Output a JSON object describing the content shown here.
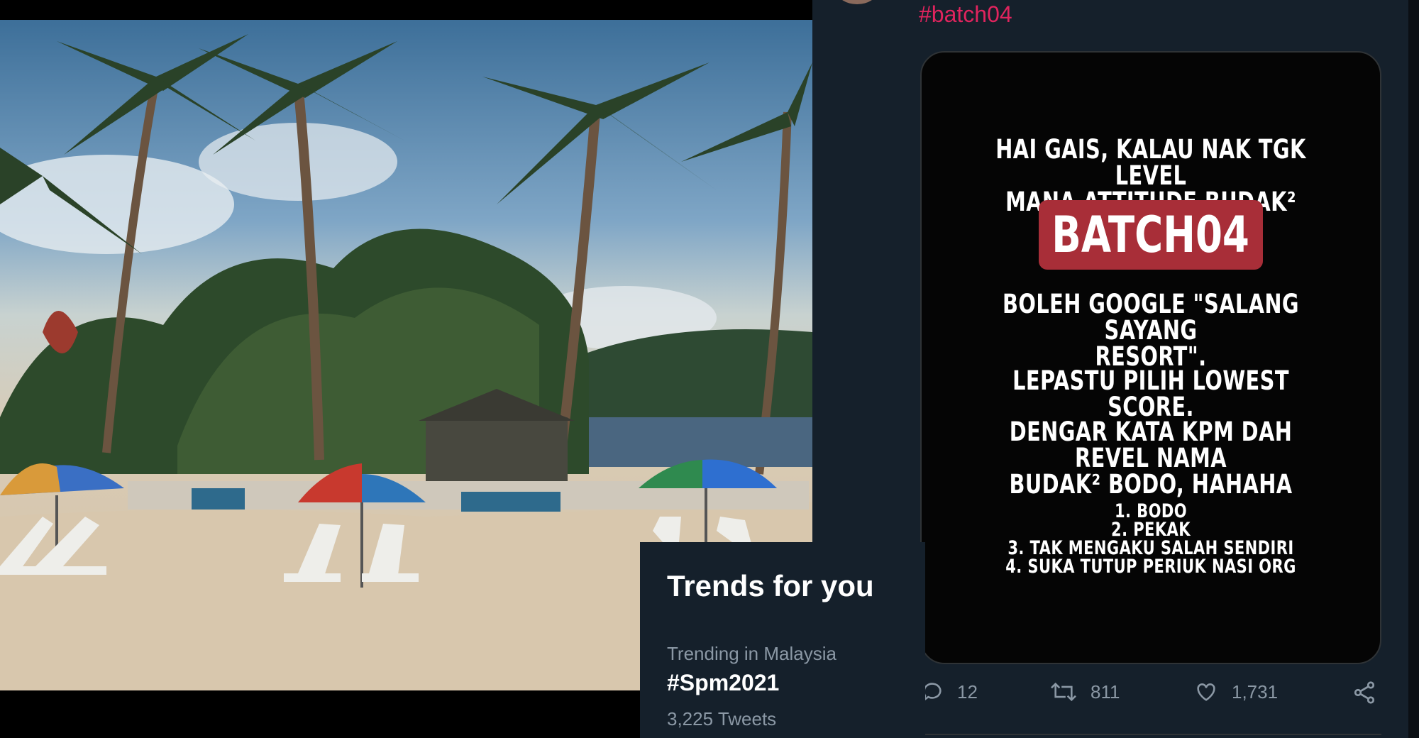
{
  "tweet": {
    "hashtag": "#batch04",
    "image_text": {
      "line1a": "HAI GAIS, KALAU NAK TGK LEVEL",
      "line1b": "MANA ATTITUDE BUDAK²",
      "badge": "BATCH04",
      "line2a": "BOLEH GOOGLE \"SALANG SAYANG",
      "line2b": "RESORT\".",
      "line3": "LEPASTU PILIH LOWEST SCORE.",
      "line4a": "DENGAR KATA KPM DAH REVEL NAMA",
      "line4b": "BUDAK² BODO, HAHAHA",
      "list": [
        "1. BODO",
        "2. PEKAK",
        "3. TAK MENGAKU SALAH SENDIRI",
        "4. SUKA TUTUP PERIUK NASI ORG"
      ]
    },
    "actions": {
      "replies": "12",
      "retweets": "811",
      "likes": "1,731"
    }
  },
  "trends": {
    "title": "Trends for you",
    "context": "Trending in Malaysia",
    "name": "#Spm2021",
    "count": "3,225 Tweets"
  },
  "colors": {
    "panel_bg": "#15202b",
    "hashtag": "#e0245e",
    "badge": "#a82e38",
    "muted": "#8b98a5"
  },
  "icons": [
    "reply-icon",
    "retweet-icon",
    "like-icon",
    "share-icon"
  ]
}
